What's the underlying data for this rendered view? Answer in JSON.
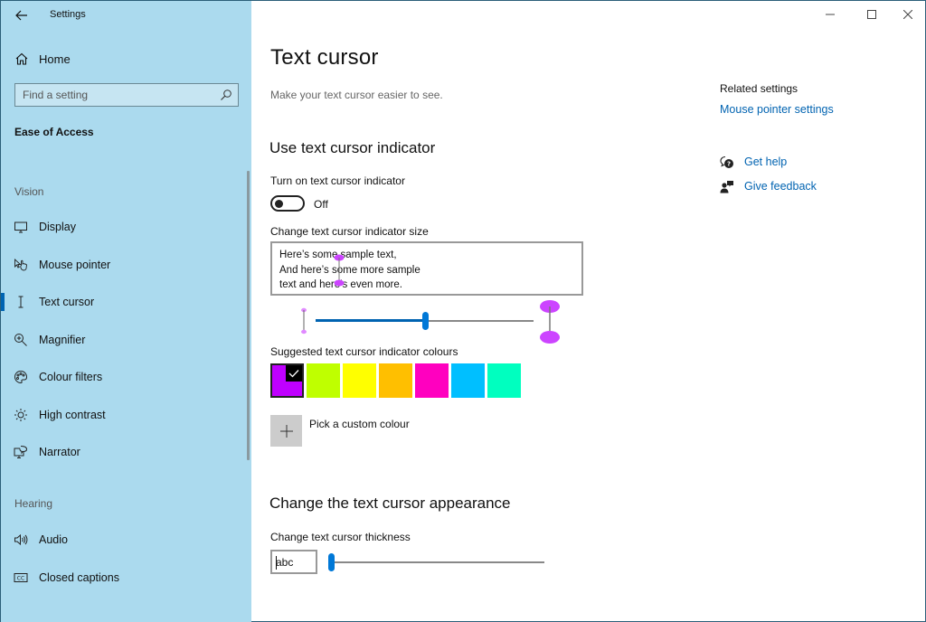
{
  "window": {
    "title": "Settings",
    "controls": {
      "minimize": "minimize-icon",
      "maximize": "maximize-icon",
      "close": "close-icon"
    }
  },
  "sidebar": {
    "home_label": "Home",
    "search_placeholder": "Find a setting",
    "category": "Ease of Access",
    "groups": [
      {
        "label": "Vision",
        "items": [
          {
            "label": "Display",
            "icon": "monitor-icon",
            "active": false
          },
          {
            "label": "Mouse pointer",
            "icon": "mouse-pointer-icon",
            "active": false
          },
          {
            "label": "Text cursor",
            "icon": "text-cursor-icon",
            "active": true
          },
          {
            "label": "Magnifier",
            "icon": "magnifier-icon",
            "active": false
          },
          {
            "label": "Colour filters",
            "icon": "palette-icon",
            "active": false
          },
          {
            "label": "High contrast",
            "icon": "sun-icon",
            "active": false
          },
          {
            "label": "Narrator",
            "icon": "narrator-icon",
            "active": false
          }
        ]
      },
      {
        "label": "Hearing",
        "items": [
          {
            "label": "Audio",
            "icon": "speaker-icon",
            "active": false
          },
          {
            "label": "Closed captions",
            "icon": "closed-captions-icon",
            "active": false
          }
        ]
      }
    ]
  },
  "main": {
    "title": "Text cursor",
    "description": "Make your text cursor easier to see.",
    "indicator_section": {
      "title": "Use text cursor indicator",
      "toggle_label": "Turn on text cursor indicator",
      "toggle_state": "Off",
      "size_label": "Change text cursor indicator size",
      "sample_text": [
        "Here’s some sample text,",
        "And here’s some more sample",
        "text and here’s even more."
      ],
      "size_slider": {
        "min": 1,
        "max": 5,
        "value": 3
      },
      "colours_label": "Suggested text cursor indicator colours",
      "colours": [
        {
          "hex": "#bf00ff",
          "selected": true
        },
        {
          "hex": "#bfff00",
          "selected": false
        },
        {
          "hex": "#ffff00",
          "selected": false
        },
        {
          "hex": "#ffbf00",
          "selected": false
        },
        {
          "hex": "#ff00bf",
          "selected": false
        },
        {
          "hex": "#00bfff",
          "selected": false
        },
        {
          "hex": "#00ffbf",
          "selected": false
        }
      ],
      "custom_colour_label": "Pick a custom colour",
      "indicator_colour": "#cc44ff"
    },
    "appearance_section": {
      "title": "Change the text cursor appearance",
      "thickness_label": "Change text cursor thickness",
      "preview_text": "abc",
      "thickness_slider": {
        "min": 1,
        "max": 20,
        "value": 1
      }
    }
  },
  "related": {
    "title": "Related settings",
    "links": [
      "Mouse pointer settings"
    ],
    "help": [
      {
        "label": "Get help",
        "icon": "get-help-icon"
      },
      {
        "label": "Give feedback",
        "icon": "give-feedback-icon"
      }
    ]
  },
  "colors": {
    "accent": "#0078d7",
    "link": "#0063b1",
    "sidebar_bg": "#abdaee"
  }
}
